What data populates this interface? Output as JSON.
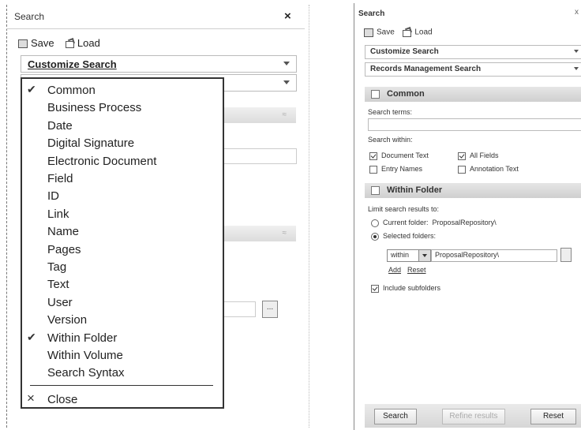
{
  "left": {
    "title": "Search",
    "close": "×",
    "toolbar": {
      "save": "Save",
      "load": "Load"
    },
    "customize_select": "Customize Search",
    "browse": "...",
    "menu": {
      "items": [
        {
          "label": "Common",
          "checked": true
        },
        {
          "label": "Business Process",
          "checked": false
        },
        {
          "label": "Date",
          "checked": false
        },
        {
          "label": "Digital Signature",
          "checked": false
        },
        {
          "label": "Electronic Document",
          "checked": false
        },
        {
          "label": "Field",
          "checked": false
        },
        {
          "label": "ID",
          "checked": false
        },
        {
          "label": "Link",
          "checked": false
        },
        {
          "label": "Name",
          "checked": false
        },
        {
          "label": "Pages",
          "checked": false
        },
        {
          "label": "Tag",
          "checked": false
        },
        {
          "label": "Text",
          "checked": false
        },
        {
          "label": "User",
          "checked": false
        },
        {
          "label": "Version",
          "checked": false
        },
        {
          "label": "Within Folder",
          "checked": true
        },
        {
          "label": "Within Volume",
          "checked": false
        },
        {
          "label": "Search Syntax",
          "checked": false
        }
      ],
      "close_icon": "×",
      "close_label": "Close"
    }
  },
  "right": {
    "title": "Search",
    "close": "x",
    "toolbar": {
      "save": "Save",
      "load": "Load"
    },
    "selects": [
      "Customize Search",
      "Records Management Search"
    ],
    "common": {
      "header": "Common",
      "search_terms_label": "Search terms:",
      "search_within_label": "Search within:",
      "options": {
        "document_text": "Document Text",
        "all_fields": "All Fields",
        "entry_names": "Entry Names",
        "annotation_text": "Annotation Text"
      }
    },
    "within_folder": {
      "header": "Within Folder",
      "limit_label": "Limit search results to:",
      "current_folder_label": "Current folder:",
      "current_folder_value": "ProposalRepository\\",
      "selected_folders_label": "Selected folders:",
      "within_value": "within",
      "folder_value": "ProposalRepository\\",
      "add": "Add",
      "reset": "Reset",
      "include_subfolders": "Include subfolders"
    },
    "footer": {
      "search": "Search",
      "refine": "Refine results",
      "reset": "Reset"
    }
  }
}
